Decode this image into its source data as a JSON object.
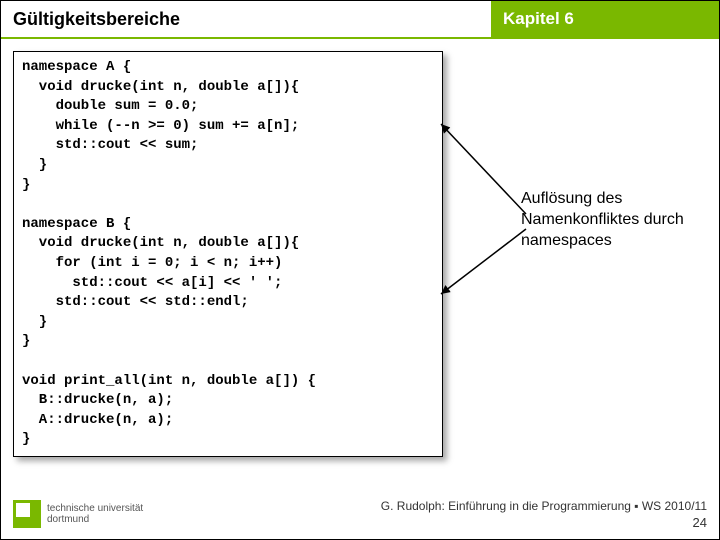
{
  "header": {
    "title_left": "Gültigkeitsbereiche",
    "title_right": "Kapitel 6"
  },
  "code": "namespace A {\n  void drucke(int n, double a[]){\n    double sum = 0.0;\n    while (--n >= 0) sum += a[n];\n    std::cout << sum;\n  }\n}\n\nnamespace B {\n  void drucke(int n, double a[]){\n    for (int i = 0; i < n; i++)\n      std::cout << a[i] << ' ';\n    std::cout << std::endl;\n  }\n}\n\nvoid print_all(int n, double a[]) {\n  B::drucke(n, a);\n  A::drucke(n, a);\n}",
  "annotation": "Auflösung des Namenkonfliktes durch namespaces",
  "footer": {
    "logo_line1": "technische universität",
    "logo_line2": "dortmund",
    "credit": "G. Rudolph: Einführung in die Programmierung ▪ WS 2010/11",
    "page": "24"
  }
}
